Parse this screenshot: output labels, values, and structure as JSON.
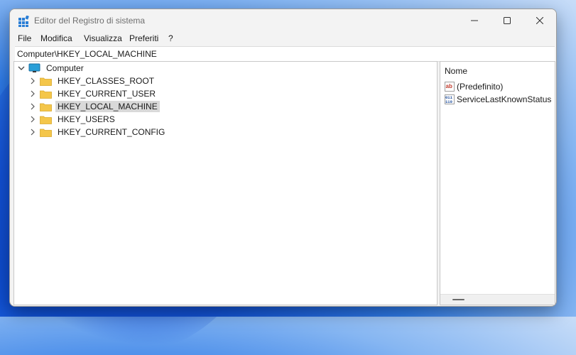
{
  "window": {
    "title": "Editor del Registro di sistema"
  },
  "menu": {
    "items": [
      "File",
      "Modifica",
      "Visualizza",
      "Preferiti",
      "?"
    ]
  },
  "address": {
    "path": "Computer\\HKEY_LOCAL_MACHINE"
  },
  "tree": {
    "root": "Computer",
    "keys": [
      "HKEY_CLASSES_ROOT",
      "HKEY_CURRENT_USER",
      "HKEY_LOCAL_MACHINE",
      "HKEY_USERS",
      "HKEY_CURRENT_CONFIG"
    ],
    "selected": "HKEY_LOCAL_MACHINE"
  },
  "values": {
    "column_header": "Nome",
    "items": [
      {
        "name": "(Predefinito)",
        "icon": "string-value-icon"
      },
      {
        "name": "ServiceLastKnownStatus",
        "icon": "binary-value-icon"
      }
    ]
  },
  "colors": {
    "folder": "#f4c64a",
    "selection": "#d9d9d9",
    "window_bg": "#f3f3f3"
  }
}
